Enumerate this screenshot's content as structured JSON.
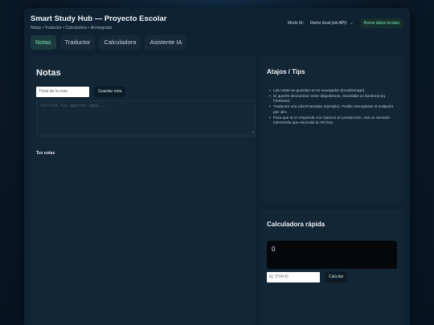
{
  "header": {
    "title": "Smart Study Hub — Proyecto Escolar",
    "subtitle": "Notas • Traductor • Calculadora • IA integrada",
    "mode_label": "Modo IA:",
    "mode_value": "Demo local (sin API)",
    "clear_label": "Borrar datos locales"
  },
  "tabs": [
    {
      "label": "Notas",
      "active": true
    },
    {
      "label": "Traductor",
      "active": false
    },
    {
      "label": "Calculadora",
      "active": false
    },
    {
      "label": "Asistente IA",
      "active": false
    }
  ],
  "notes": {
    "title": "Notas",
    "title_placeholder": "Título de la nota",
    "save_label": "Guardar nota",
    "body_placeholder": "Escribí tus apuntes aquí...",
    "list_title": "Tus notas"
  },
  "tips": {
    "title": "Atajos / Tips",
    "items": [
      "Las notas se guardan en tu navegador (localStorage).",
      "Si querés sincronizar entre dispositivos, necesitás un backend (ej. Firebase).",
      "Traductor usa LibreTranslate (ejemplo). Podés reemplazar el endpoint por otro.",
      "Para que la IA responda con OpenAI en producción, usá un servidor intermedio que esconda la API key."
    ]
  },
  "calc": {
    "title": "Calculadora rápida",
    "display": "0",
    "input_placeholder": "Ej: 3*(4+5)",
    "button_label": "Calcular"
  }
}
